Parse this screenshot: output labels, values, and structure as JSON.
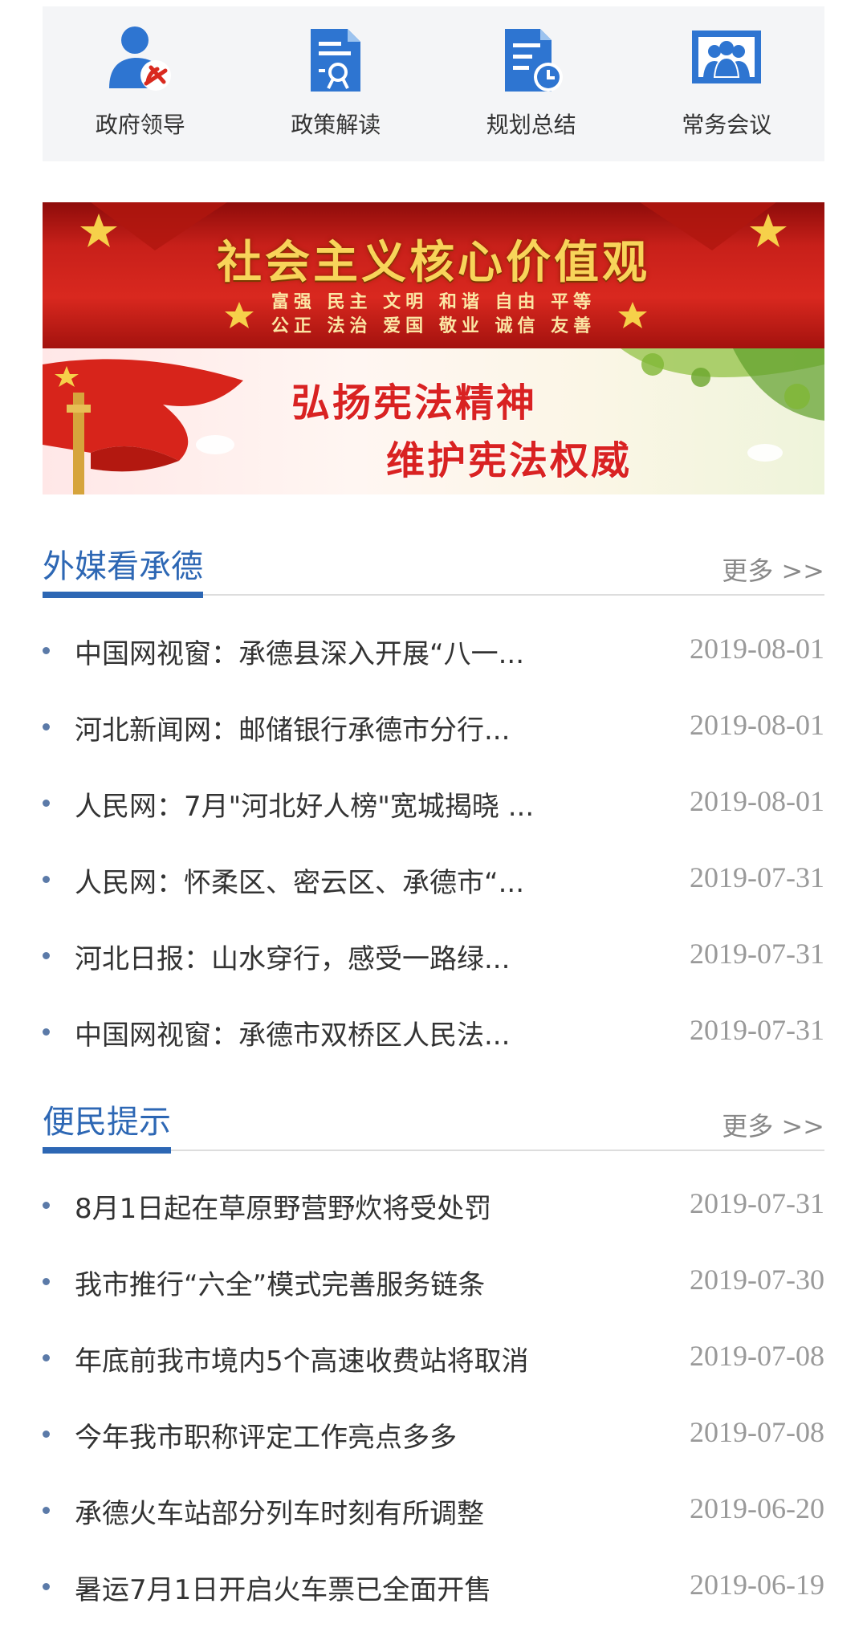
{
  "quick_links": [
    {
      "label": "政府领导",
      "icon": "leader-icon"
    },
    {
      "label": "政策解读",
      "icon": "policy-document-icon"
    },
    {
      "label": "规划总结",
      "icon": "plan-clock-icon"
    },
    {
      "label": "常务会议",
      "icon": "meeting-icon"
    }
  ],
  "banners": {
    "core_values": {
      "title": "社会主义核心价值观",
      "line1": "富强 民主 文明 和谐 自由 平等",
      "line2": "公正 法治 爱国 敬业 诚信 友善"
    },
    "constitution": {
      "line1": "弘扬宪法精神",
      "line2": "维护宪法权威"
    }
  },
  "sections": [
    {
      "title": "外媒看承德",
      "more": "更多 >>",
      "items": [
        {
          "title": "中国网视窗：承德县深入开展“八一...",
          "date": "2019-08-01"
        },
        {
          "title": "河北新闻网：邮储银行承德市分行...",
          "date": "2019-08-01"
        },
        {
          "title": "人民网：7月\"河北好人榜\"宽城揭晓 ...",
          "date": "2019-08-01"
        },
        {
          "title": "人民网：怀柔区、密云区、承德市“...",
          "date": "2019-07-31"
        },
        {
          "title": "河北日报：山水穿行，感受一路绿...",
          "date": "2019-07-31"
        },
        {
          "title": "中国网视窗：承德市双桥区人民法...",
          "date": "2019-07-31"
        }
      ]
    },
    {
      "title": "便民提示",
      "more": "更多 >>",
      "items": [
        {
          "title": "8月1日起在草原野营野炊将受处罚",
          "date": "2019-07-31"
        },
        {
          "title": "我市推行“六全”模式完善服务链条",
          "date": "2019-07-30"
        },
        {
          "title": "年底前我市境内5个高速收费站将取消",
          "date": "2019-07-08"
        },
        {
          "title": "今年我市职称评定工作亮点多多",
          "date": "2019-07-08"
        },
        {
          "title": "承德火车站部分列车时刻有所调整",
          "date": "2019-06-20"
        },
        {
          "title": "暑运7月1日开启火车票已全面开售",
          "date": "2019-06-19"
        }
      ]
    }
  ],
  "colors": {
    "accent": "#2d67b4",
    "icon_blue": "#2e75d1",
    "date_gray": "#999999"
  }
}
